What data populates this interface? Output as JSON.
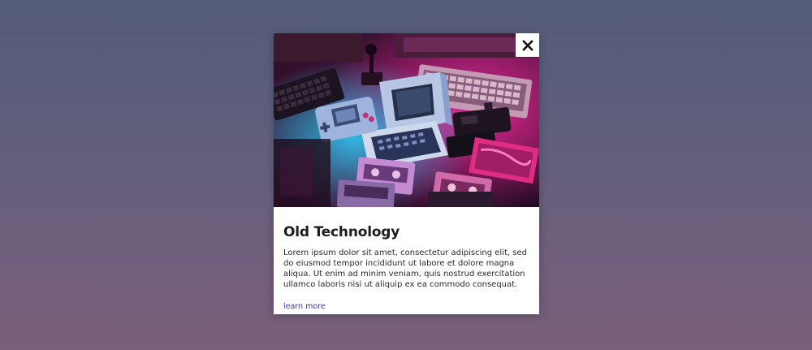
{
  "card": {
    "title": "Old Technology",
    "description": "Lorem ipsum dolor sit amet, consectetur adipiscing elit, sed do eiusmod tempor incididunt ut labore et dolore magna aliqua. Ut enim ad minim veniam, quis nostrud exercitation ullamco laboris nisi ut aliquip ex ea commodo consequat.",
    "link_label": "learn more",
    "close_label": "✕",
    "image_subject": "retro computers, game consoles and cassettes in neon pink and blue light"
  },
  "colors": {
    "background_top": "#545c78",
    "background_bottom": "#7a5e7a",
    "card": "#ffffff",
    "title": "#1d1d1d",
    "link": "#3a3a9a",
    "neon_pink": "#e0288a",
    "neon_blue": "#2bc4ee"
  },
  "icons": {
    "close": "close-icon"
  }
}
